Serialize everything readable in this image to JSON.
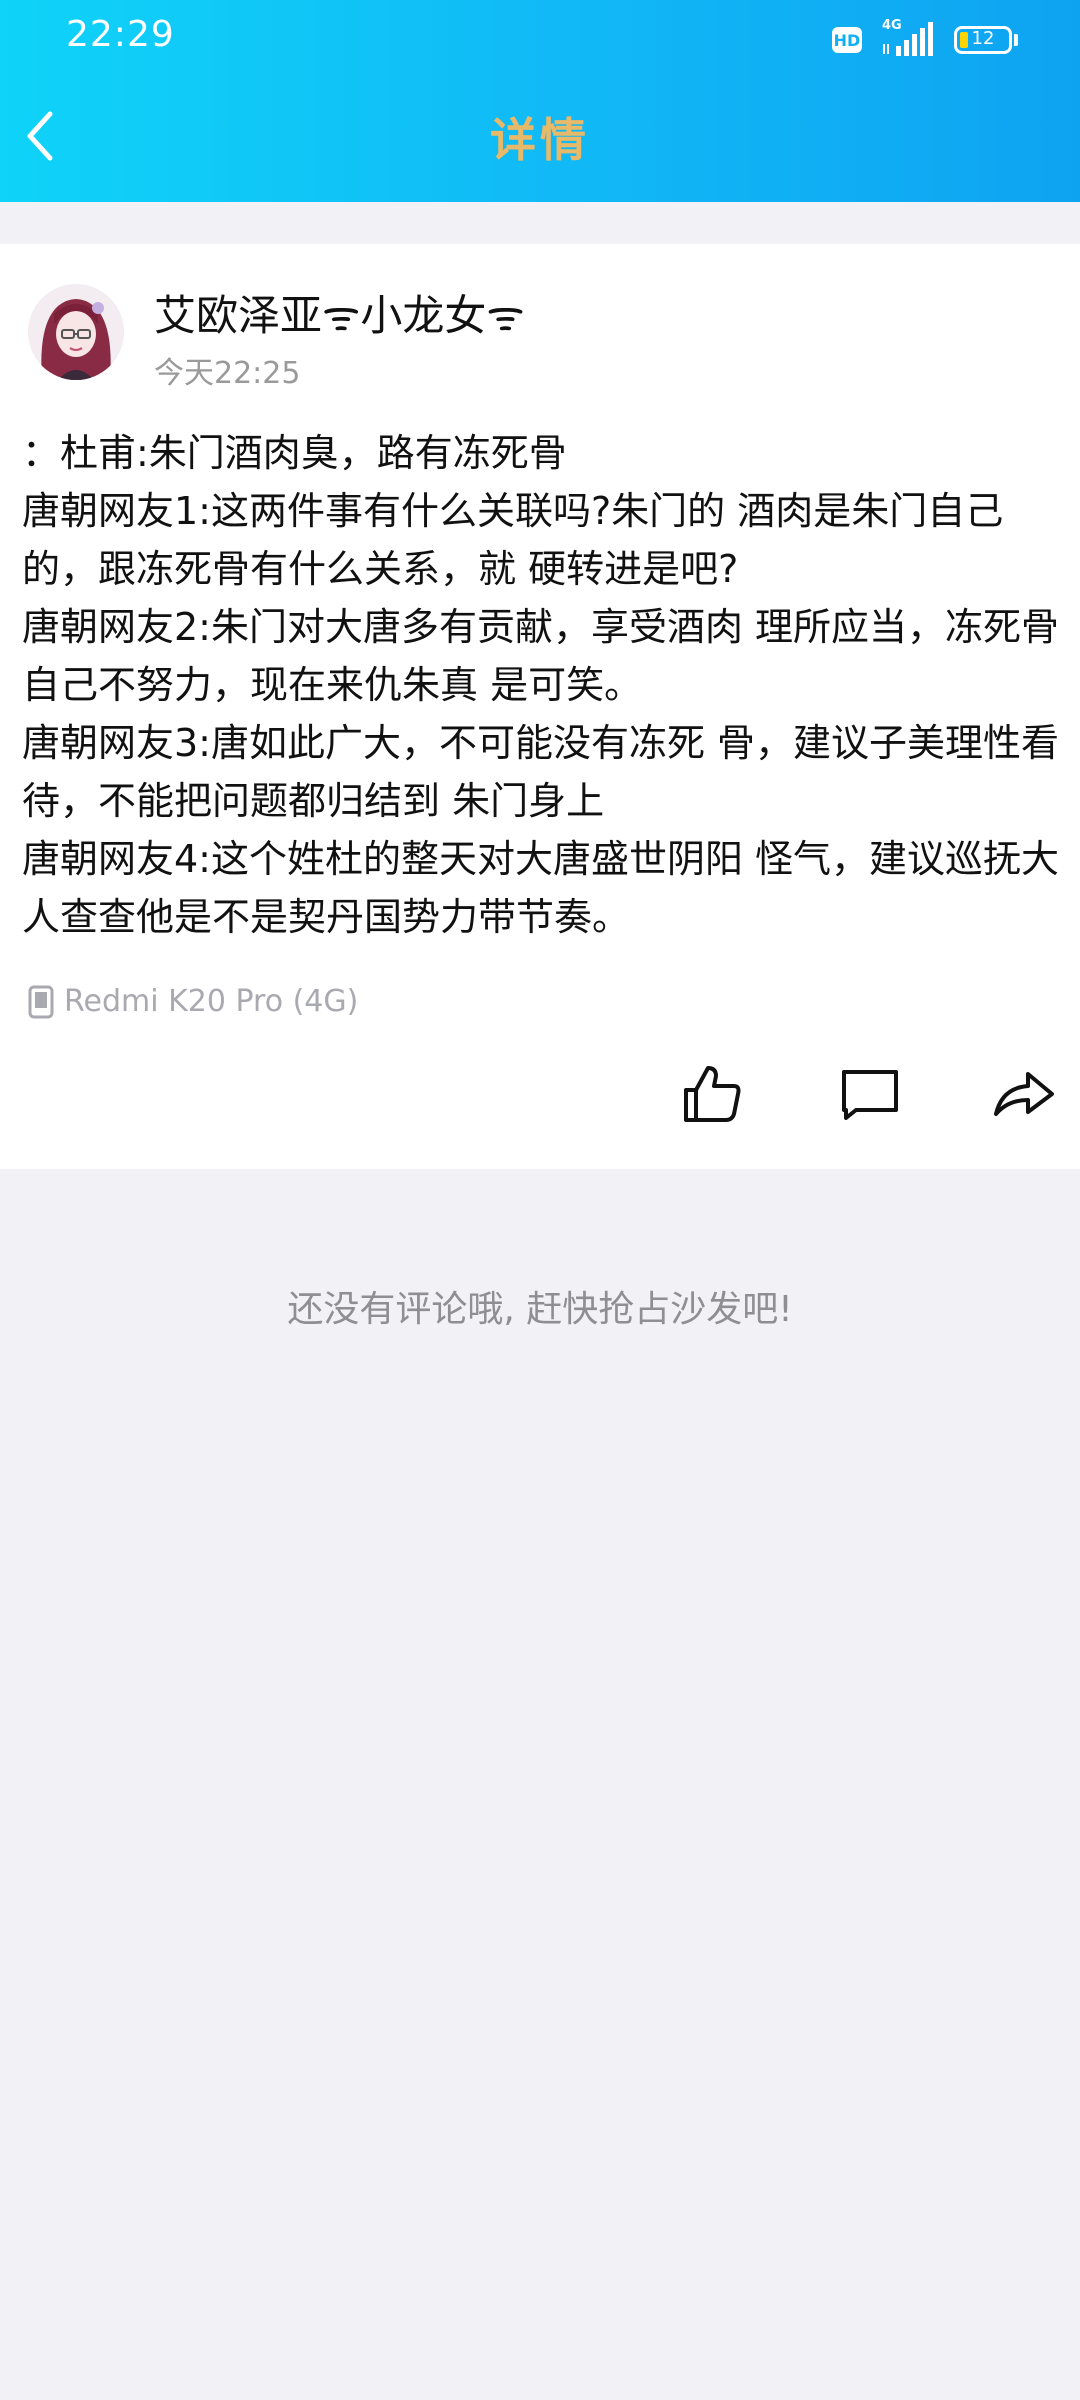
{
  "status_bar": {
    "time": "22:29",
    "hd": "HD",
    "network": "4G",
    "battery": "12",
    "battery_level": 0.12
  },
  "header": {
    "title": "详情",
    "back_icon": "chevron-left-icon",
    "title_color": "#e7b968"
  },
  "post": {
    "author": "艾欧泽亚ᯤ小龙女ᯤ",
    "time": "今天22:25",
    "content": "：杜甫:朱门酒肉臭，路有冻死骨\n唐朝网友1:这两件事有什么关联吗?朱门的 酒肉是朱门自己的，跟冻死骨有什么关系，就 硬转进是吧?\n唐朝网友2:朱门对大唐多有贡献，享受酒肉 理所应当，冻死骨自己不努力，现在来仇朱真 是可笑。\n唐朝网友3:唐如此广大，不可能没有冻死 骨，建议子美理性看待，不能把问题都归结到 朱门身上\n唐朝网友4:这个姓杜的整天对大唐盛世阴阳 怪气，建议巡抚大人查查他是不是契丹国势力带节奏。",
    "device": "Redmi K20 Pro (4G)",
    "device_icon": "phone-icon"
  },
  "actions": {
    "like_icon": "thumbs-up-icon",
    "comment_icon": "comment-icon",
    "share_icon": "share-icon"
  },
  "comments": {
    "empty_text": "还没有评论哦, 赶快抢占沙发吧!"
  }
}
